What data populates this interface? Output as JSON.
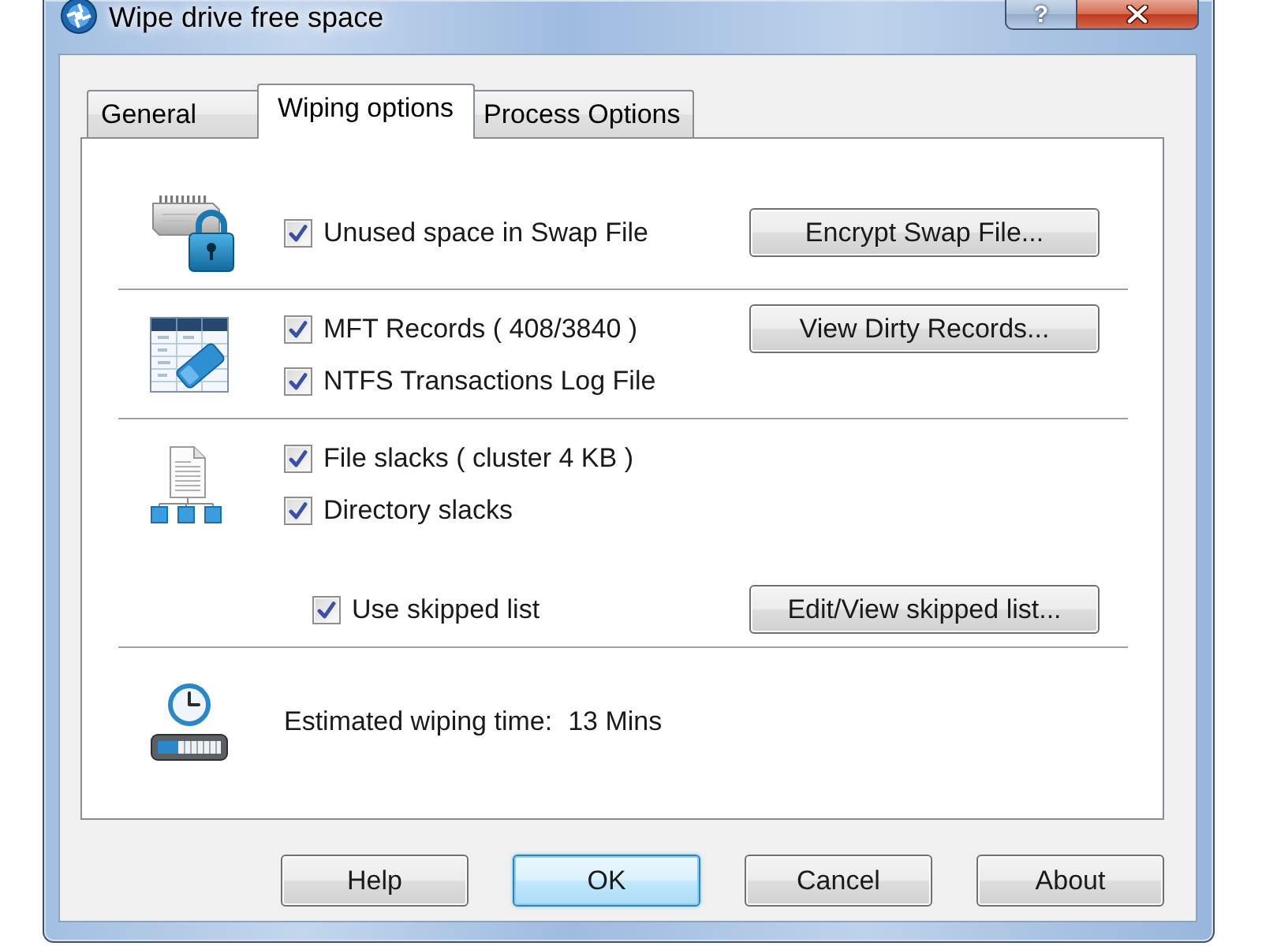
{
  "window": {
    "title": "Wipe drive free space",
    "controls": [
      {
        "kind": "help",
        "label": "?"
      },
      {
        "kind": "close"
      }
    ]
  },
  "tabs": [
    {
      "label": "General",
      "selected": false
    },
    {
      "label": "Wiping options",
      "selected": true
    },
    {
      "label": "Process Options",
      "selected": false
    }
  ],
  "sections": [
    {
      "kind": "swap",
      "options": [
        {
          "label": "Unused space in Swap File",
          "checked": true
        }
      ],
      "button": "Encrypt Swap File..."
    },
    {
      "kind": "mft",
      "options": [
        {
          "label": "MFT Records ( 408/3840 )",
          "checked": true
        },
        {
          "label": "NTFS Transactions Log File",
          "checked": true
        }
      ],
      "button": "View Dirty Records..."
    },
    {
      "kind": "slack",
      "options": [
        {
          "label": "File slacks ( cluster 4 KB )",
          "checked": true
        },
        {
          "label": "Directory slacks",
          "checked": true
        }
      ],
      "skipped_list": {
        "label": "Use skipped list",
        "checked": true,
        "button": "Edit/View skipped list..."
      }
    },
    {
      "kind": "estimate",
      "label": "Estimated wiping time:",
      "value": "13 Mins"
    }
  ],
  "buttons": [
    {
      "label": "Help",
      "default": false
    },
    {
      "label": "OK",
      "default": true
    },
    {
      "label": "Cancel",
      "default": false
    },
    {
      "label": "About",
      "default": false
    }
  ]
}
